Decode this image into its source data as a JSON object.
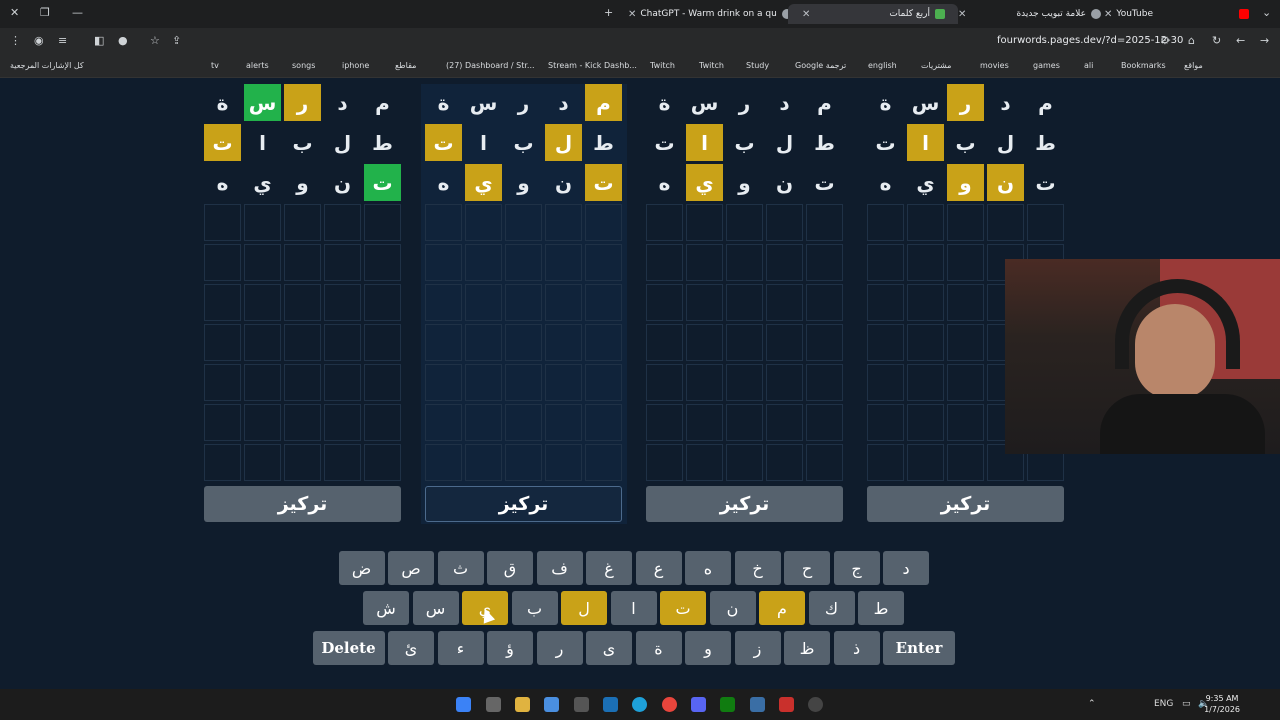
{
  "browser": {
    "tabs": [
      {
        "title": "YouTube",
        "color": "#ff0000"
      },
      {
        "title": "علامة تبويب جديدة",
        "color": "#9aa0a6"
      },
      {
        "title": "أربع كلمات",
        "color": "#4caf50"
      },
      {
        "title": "ChatGPT - Warm drink on a qu",
        "color": "#9aa0a6"
      }
    ],
    "url": "fourwords.pages.dev/?d=2025-12-30",
    "bookmarks": [
      "كل الإشارات المرجعية",
      "tv",
      "alerts",
      "songs",
      "iphone",
      "مقاطع",
      "(27) Dashboard / Str...",
      "Stream - Kick Dashb...",
      "Twitch",
      "Twitch",
      "Study",
      "Google ترجمة",
      "english",
      "مشتريات",
      "movies",
      "games",
      "ali",
      "Bookmarks",
      "مواقع"
    ]
  },
  "boards": [
    {
      "rows": [
        [
          "م",
          "د",
          "ر",
          "س",
          "ة"
        ],
        [
          "ط",
          "ل",
          "ب",
          "ا",
          "ت"
        ],
        [
          "ت",
          "ن",
          "و",
          "ي",
          "ه"
        ]
      ],
      "states": [
        [
          "",
          "",
          "y",
          "g",
          ""
        ],
        [
          "",
          "",
          "",
          "",
          "y"
        ],
        [
          "g",
          "",
          "",
          "",
          ""
        ]
      ],
      "focus_label": "تركيز",
      "focused": false
    },
    {
      "rows": [
        [
          "م",
          "د",
          "ر",
          "س",
          "ة"
        ],
        [
          "ط",
          "ل",
          "ب",
          "ا",
          "ت"
        ],
        [
          "ت",
          "ن",
          "و",
          "ي",
          "ه"
        ]
      ],
      "states": [
        [
          "y",
          "",
          "",
          "",
          ""
        ],
        [
          "",
          "y",
          "",
          "",
          "y"
        ],
        [
          "y",
          "",
          "",
          "y",
          ""
        ]
      ],
      "focus_label": "تركيز",
      "focused": true
    },
    {
      "rows": [
        [
          "م",
          "د",
          "ر",
          "س",
          "ة"
        ],
        [
          "ط",
          "ل",
          "ب",
          "ا",
          "ت"
        ],
        [
          "ت",
          "ن",
          "و",
          "ي",
          "ه"
        ]
      ],
      "states": [
        [
          "",
          "",
          "",
          "",
          ""
        ],
        [
          "",
          "",
          "",
          "y",
          ""
        ],
        [
          "",
          "",
          "",
          "y",
          ""
        ]
      ],
      "focus_label": "تركيز",
      "focused": false
    },
    {
      "rows": [
        [
          "م",
          "د",
          "ر",
          "س",
          "ة"
        ],
        [
          "ط",
          "ل",
          "ب",
          "ا",
          "ت"
        ],
        [
          "ت",
          "ن",
          "و",
          "ي",
          "ه"
        ]
      ],
      "states": [
        [
          "",
          "",
          "y",
          "",
          ""
        ],
        [
          "",
          "",
          "",
          "y",
          ""
        ],
        [
          "",
          "y",
          "y",
          "",
          ""
        ]
      ],
      "focus_label": "تركيز",
      "focused": false
    }
  ],
  "keyboard": {
    "row1": [
      {
        "k": "د"
      },
      {
        "k": "ج"
      },
      {
        "k": "ح"
      },
      {
        "k": "خ"
      },
      {
        "k": "ه"
      },
      {
        "k": "ع"
      },
      {
        "k": "غ"
      },
      {
        "k": "ف"
      },
      {
        "k": "ق"
      },
      {
        "k": "ث"
      },
      {
        "k": "ص"
      },
      {
        "k": "ض"
      }
    ],
    "row2": [
      {
        "k": "ط"
      },
      {
        "k": "ك"
      },
      {
        "k": "م",
        "s": "y"
      },
      {
        "k": "ن"
      },
      {
        "k": "ت",
        "s": "y"
      },
      {
        "k": "ا"
      },
      {
        "k": "ل",
        "s": "y"
      },
      {
        "k": "ب"
      },
      {
        "k": "ي",
        "s": "y"
      },
      {
        "k": "س"
      },
      {
        "k": "ش"
      }
    ],
    "row3": [
      {
        "k": "Enter",
        "wide": true
      },
      {
        "k": "ذ"
      },
      {
        "k": "ظ"
      },
      {
        "k": "ز"
      },
      {
        "k": "و"
      },
      {
        "k": "ة"
      },
      {
        "k": "ى"
      },
      {
        "k": "ر"
      },
      {
        "k": "ؤ"
      },
      {
        "k": "ء"
      },
      {
        "k": "ئ"
      },
      {
        "k": "Delete",
        "wide": true
      }
    ]
  },
  "taskbar": {
    "lang": "ENG",
    "time": "9:35 AM",
    "date": "1/7/2026"
  },
  "colors": {
    "yellow": "#c9a218",
    "green": "#22b24b",
    "key": "#56626e",
    "bg": "#0f1c2c"
  }
}
